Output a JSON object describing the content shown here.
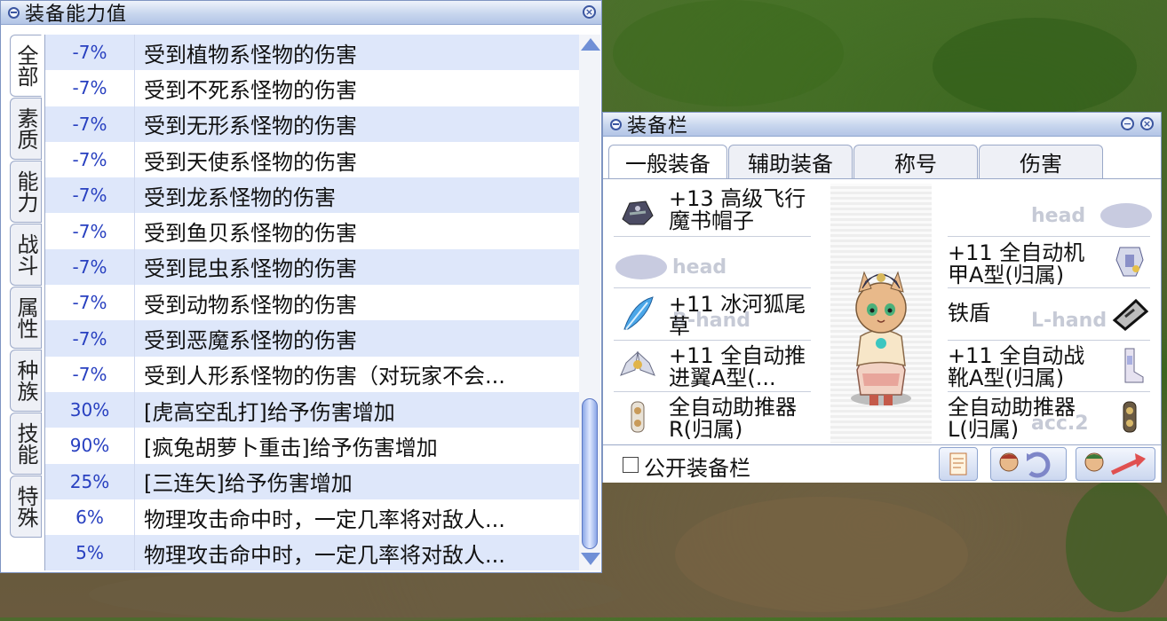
{
  "stat_window": {
    "title": "装备能力值",
    "side_tabs": [
      "全部",
      "素质",
      "能力",
      "战斗",
      "属性",
      "种族",
      "技能",
      "特殊"
    ],
    "rows": [
      {
        "value": "-7%",
        "desc": "受到植物系怪物的伤害"
      },
      {
        "value": "-7%",
        "desc": "受到不死系怪物的伤害"
      },
      {
        "value": "-7%",
        "desc": "受到无形系怪物的伤害"
      },
      {
        "value": "-7%",
        "desc": "受到天使系怪物的伤害"
      },
      {
        "value": "-7%",
        "desc": "受到龙系怪物的伤害"
      },
      {
        "value": "-7%",
        "desc": "受到鱼贝系怪物的伤害"
      },
      {
        "value": "-7%",
        "desc": "受到昆虫系怪物的伤害"
      },
      {
        "value": "-7%",
        "desc": "受到动物系怪物的伤害"
      },
      {
        "value": "-7%",
        "desc": "受到恶魔系怪物的伤害"
      },
      {
        "value": "-7%",
        "desc": "受到人形系怪物的伤害（对玩家不会..."
      },
      {
        "value": "30%",
        "desc": "[虎高空乱打]给予伤害增加"
      },
      {
        "value": "90%",
        "desc": "[疯兔胡萝卜重击]给予伤害增加"
      },
      {
        "value": "25%",
        "desc": "[三连矢]给予伤害增加"
      },
      {
        "value": "6%",
        "desc": "物理攻击命中时，一定几率将对敌人..."
      },
      {
        "value": "5%",
        "desc": "物理攻击命中时，一定几率将对敌人..."
      }
    ]
  },
  "equip_window": {
    "title": "装备栏",
    "tabs": [
      "一般装备",
      "辅助装备",
      "称号",
      "伤害"
    ],
    "left_slots": [
      {
        "line1": "+13 高级飞行",
        "line2": "魔书帽子",
        "icon": "hat-icon"
      },
      {
        "line1": "",
        "line2": "",
        "ghost": "head"
      },
      {
        "line1": "+11 冰河狐尾",
        "line2": "草",
        "icon": "feather-icon",
        "ghost": "R-hand"
      },
      {
        "line1": "+11 全自动推",
        "line2": "进翼A型(...",
        "icon": "wing-icon"
      },
      {
        "line1": "全自动助推器",
        "line2": "R(归属)",
        "icon": "booster-icon"
      }
    ],
    "right_slots": [
      {
        "line1": "",
        "line2": "",
        "ghost": "head"
      },
      {
        "line1": "+11 全自动机",
        "line2": "甲A型(归属)",
        "icon": "armor-icon"
      },
      {
        "line1": "铁盾",
        "line2": "",
        "icon": "shield-icon",
        "ghost": "L-hand"
      },
      {
        "line1": "+11 全自动战",
        "line2": "靴A型(归属)",
        "icon": "boots-icon"
      },
      {
        "line1": "全自动助推器",
        "line2": "L(归属)",
        "icon": "booster-icon",
        "ghost": "acc.2"
      }
    ],
    "public_checkbox_label": "公开装备栏",
    "public_checked": false,
    "colors": {
      "accent": "#3b56a0",
      "row_tint": "#dee7fa",
      "value_text": "#2840c0"
    }
  }
}
